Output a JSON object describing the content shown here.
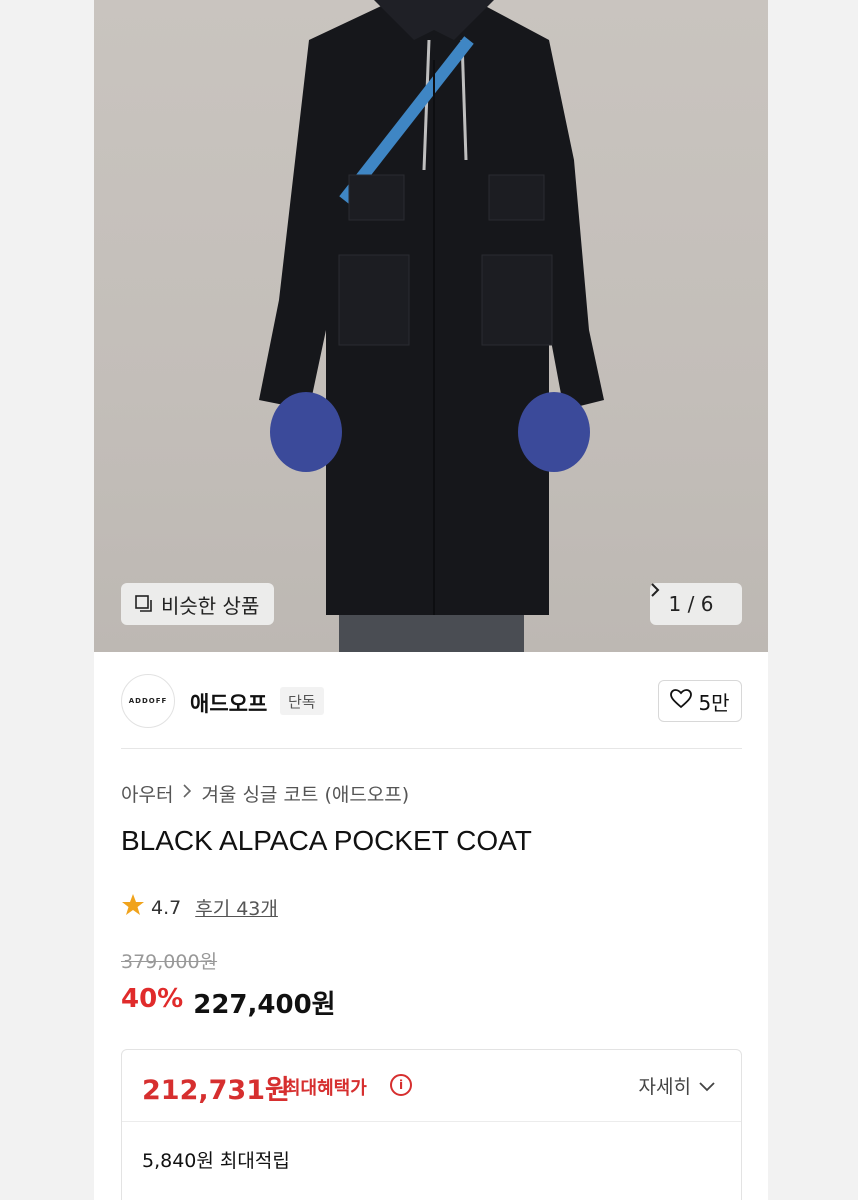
{
  "hero": {
    "similar_label": "비슷한 상품",
    "counter": "1 / 6"
  },
  "brand": {
    "logo_text": "ADDOFF",
    "name": "애드오프",
    "badge": "단독",
    "likes": "5만"
  },
  "breadcrumb": {
    "items": [
      "아우터",
      "겨울 싱글 코트 (애드오프)"
    ]
  },
  "product": {
    "title": "BLACK ALPACA POCKET COAT",
    "rating": "4.7",
    "reviews": "후기 43개",
    "original_price": "379,000원",
    "discount": "40%",
    "sale_price": "227,400원"
  },
  "benefit": {
    "max_price": "212,731원",
    "max_label": "최대혜택가",
    "detail_label": "자세히",
    "points": "5,840원 최대적립"
  },
  "colors": {
    "accent_red": "#e02b2b",
    "star": "#f0a31c"
  }
}
